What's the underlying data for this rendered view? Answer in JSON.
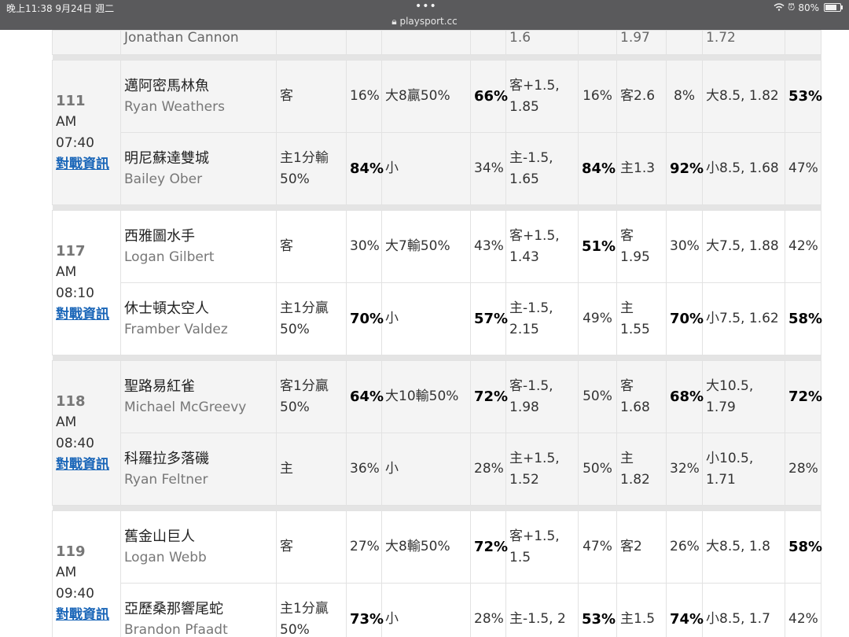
{
  "statusbar": {
    "time": "晚上11:38  9月24日 週二",
    "dots": "•••",
    "url": "playsport.cc",
    "battery": "80%",
    "battery_level": 0.8
  },
  "top_partial": {
    "player": "Jonathan Cannon",
    "spread_line": "1.6",
    "ml_line": "1.97",
    "total_line": "1.72"
  },
  "games": [
    {
      "num": "111",
      "ampm": "AM",
      "time": "07:40",
      "link": "對戰資訊",
      "rows": [
        {
          "team": "邁阿密馬林魚",
          "player": "Ryan Weathers",
          "sp_line": "客",
          "sp_pct": "16%",
          "ou_line": "大8贏50%",
          "ou_pct": "66%",
          "rl_line": "客+1.5, 1.85",
          "rl_pct": "16%",
          "ml_line": "客2.6",
          "ml_pct": "8%",
          "tot_line": "大8.5, 1.82",
          "tot_pct": "53%"
        },
        {
          "team": "明尼蘇達雙城",
          "player": "Bailey Ober",
          "sp_line": "主1分輸50%",
          "sp_pct": "84%",
          "ou_line": "小",
          "ou_pct": "34%",
          "rl_line": "主-1.5, 1.65",
          "rl_pct": "84%",
          "ml_line": "主1.3",
          "ml_pct": "92%",
          "tot_line": "小8.5, 1.68",
          "tot_pct": "47%"
        }
      ]
    },
    {
      "num": "117",
      "ampm": "AM",
      "time": "08:10",
      "link": "對戰資訊",
      "rows": [
        {
          "team": "西雅圖水手",
          "player": "Logan Gilbert",
          "sp_line": "客",
          "sp_pct": "30%",
          "ou_line": "大7輸50%",
          "ou_pct": "43%",
          "rl_line": "客+1.5, 1.43",
          "rl_pct": "51%",
          "ml_line": "客 1.95",
          "ml_pct": "30%",
          "tot_line": "大7.5, 1.88",
          "tot_pct": "42%"
        },
        {
          "team": "休士頓太空人",
          "player": "Framber Valdez",
          "sp_line": "主1分贏50%",
          "sp_pct": "70%",
          "ou_line": "小",
          "ou_pct": "57%",
          "rl_line": "主-1.5, 2.15",
          "rl_pct": "49%",
          "ml_line": "主 1.55",
          "ml_pct": "70%",
          "tot_line": "小7.5, 1.62",
          "tot_pct": "58%"
        }
      ]
    },
    {
      "num": "118",
      "ampm": "AM",
      "time": "08:40",
      "link": "對戰資訊",
      "rows": [
        {
          "team": "聖路易紅雀",
          "player": "Michael McGreevy",
          "sp_line": "客1分贏50%",
          "sp_pct": "64%",
          "ou_line": "大10輸50%",
          "ou_pct": "72%",
          "rl_line": "客-1.5, 1.98",
          "rl_pct": "50%",
          "ml_line": "客 1.68",
          "ml_pct": "68%",
          "tot_line": "大10.5, 1.79",
          "tot_pct": "72%"
        },
        {
          "team": "科羅拉多落磯",
          "player": "Ryan Feltner",
          "sp_line": "主",
          "sp_pct": "36%",
          "ou_line": "小",
          "ou_pct": "28%",
          "rl_line": "主+1.5, 1.52",
          "rl_pct": "50%",
          "ml_line": "主 1.82",
          "ml_pct": "32%",
          "tot_line": "小10.5, 1.71",
          "tot_pct": "28%"
        }
      ]
    },
    {
      "num": "119",
      "ampm": "AM",
      "time": "09:40",
      "link": "對戰資訊",
      "rows": [
        {
          "team": "舊金山巨人",
          "player": "Logan Webb",
          "sp_line": "客",
          "sp_pct": "27%",
          "ou_line": "大8輸50%",
          "ou_pct": "72%",
          "rl_line": "客+1.5, 1.5",
          "rl_pct": "47%",
          "ml_line": "客2",
          "ml_pct": "26%",
          "tot_line": "大8.5, 1.8",
          "tot_pct": "58%"
        },
        {
          "team": "亞歷桑那響尾蛇",
          "player": "Brandon Pfaadt",
          "sp_line": "主1分贏50%",
          "sp_pct": "73%",
          "ou_line": "小",
          "ou_pct": "28%",
          "rl_line": "主-1.5, 2",
          "rl_pct": "53%",
          "ml_line": "主1.5",
          "ml_pct": "74%",
          "tot_line": "小8.5, 1.7",
          "tot_pct": "42%"
        }
      ]
    }
  ]
}
